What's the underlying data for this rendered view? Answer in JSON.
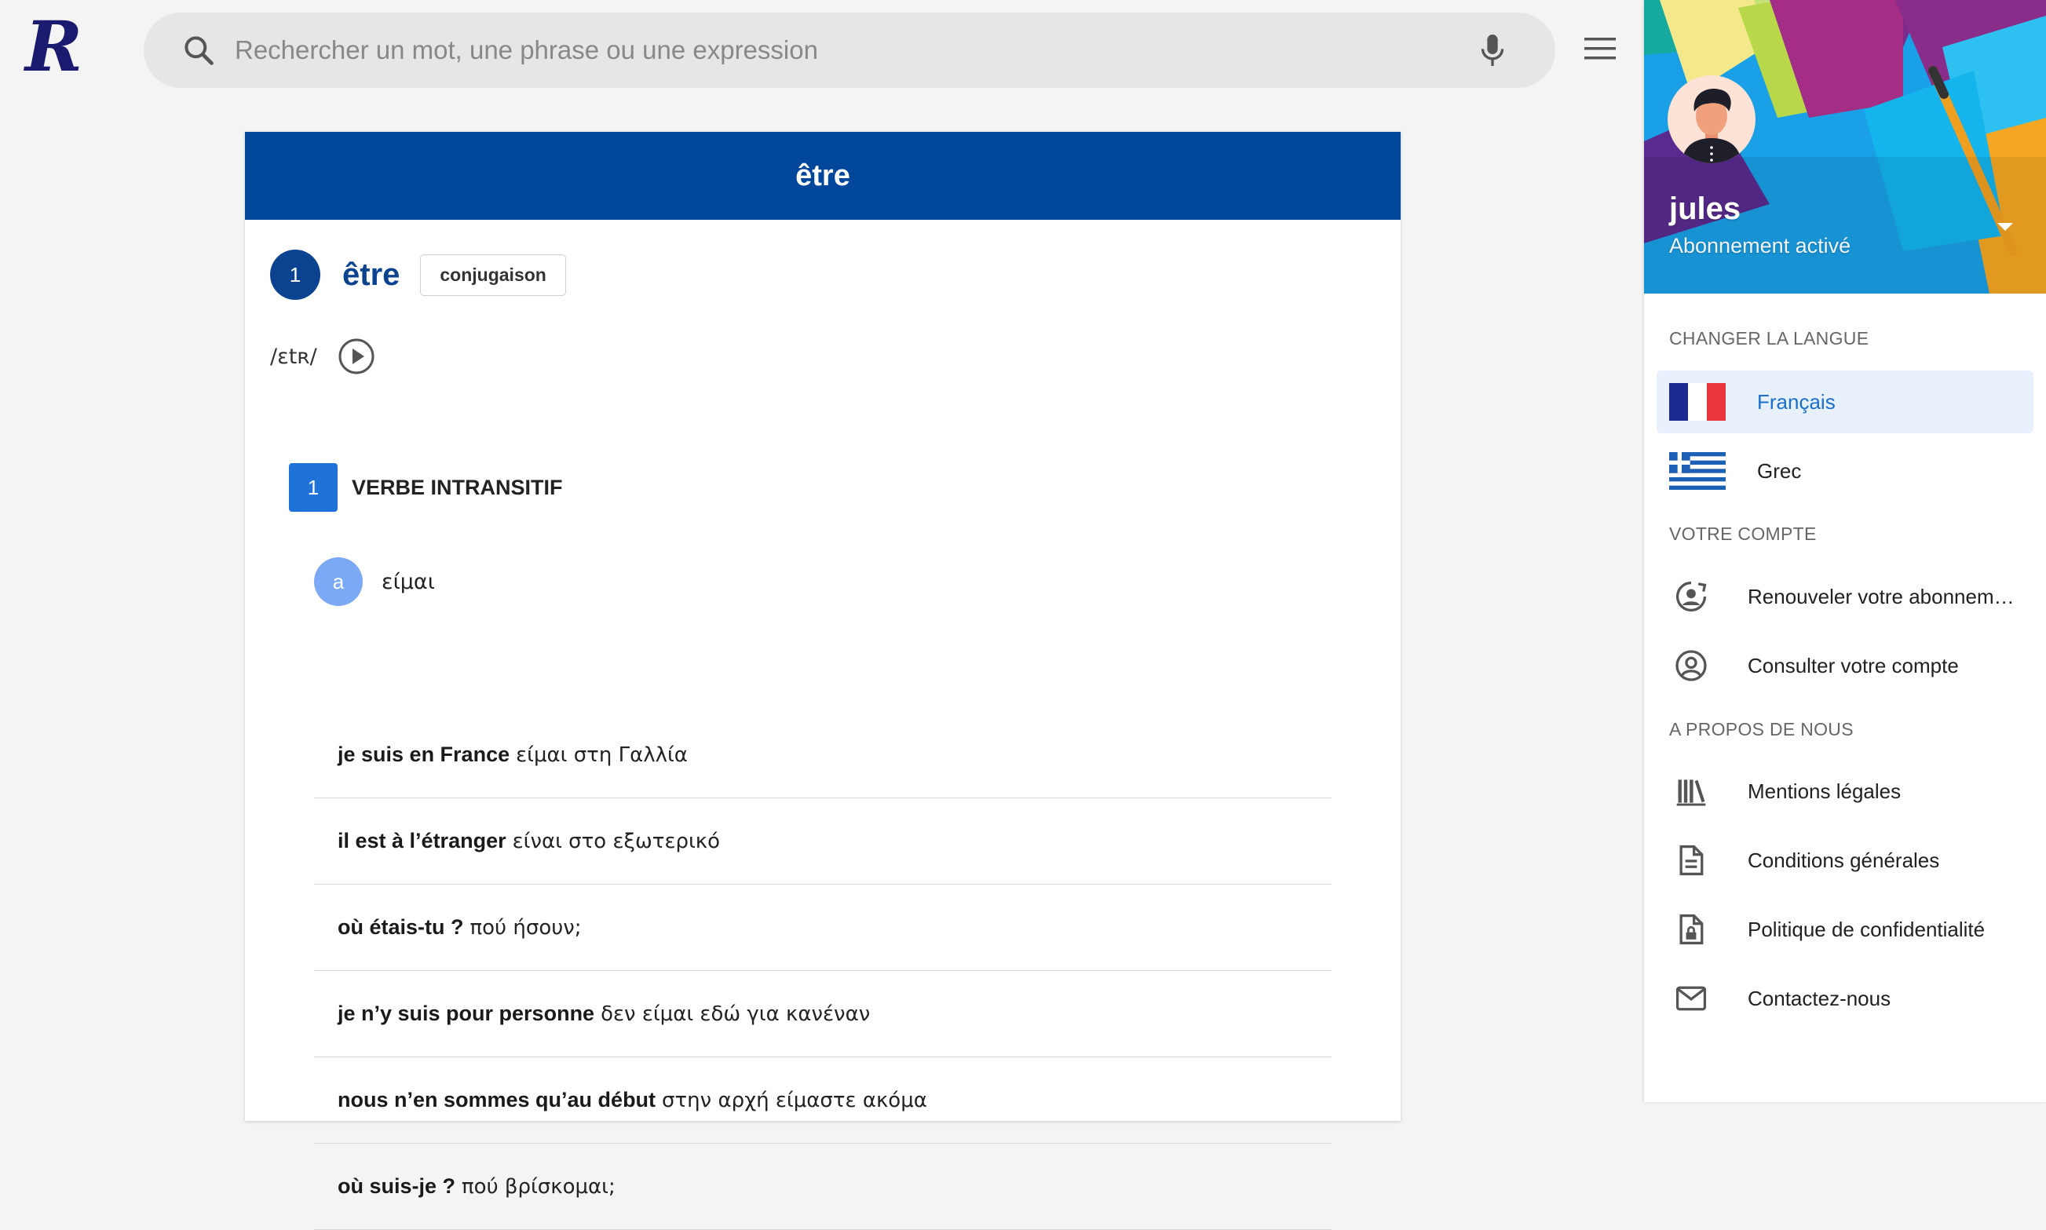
{
  "header": {
    "logo_letter": "R",
    "search": {
      "placeholder": "Rechercher un mot, une phrase ou une expression",
      "value": ""
    },
    "icons": {
      "search": "search-icon",
      "mic": "mic-icon",
      "menu": "menu-icon"
    }
  },
  "card": {
    "title": "être",
    "entry_number": "1",
    "headword": "être",
    "conjugation_button": "conjugaison",
    "phonetic": "/ɛtʀ/",
    "sense": {
      "number": "1",
      "label": "VERBE INTRANSITIF"
    },
    "translation": {
      "letter": "a",
      "text": "είμαι"
    },
    "examples": [
      {
        "fr": "je suis en France",
        "gr": "είμαι στη Γαλλία"
      },
      {
        "fr": "il est à l’étranger",
        "gr": "είναι στο εξωτερικό"
      },
      {
        "fr": "où étais-tu ?",
        "gr": "πού ήσουν;"
      },
      {
        "fr": "je n’y suis pour personne",
        "gr": "δεν είμαι εδώ για κανέναν"
      },
      {
        "fr": "nous n’en sommes qu’au début",
        "gr": "στην αρχή είμαστε ακόμα"
      },
      {
        "fr": "où suis-je ?",
        "gr": "πού βρίσκομαι;"
      }
    ]
  },
  "panel": {
    "user": {
      "name": "jules",
      "status": "Abonnement activé"
    },
    "sections": {
      "language": "CHANGER LA LANGUE",
      "account": "VOTRE COMPTE",
      "about": "A PROPOS DE NOUS"
    },
    "languages": [
      {
        "label": "Français",
        "flag": "france-flag",
        "active": true
      },
      {
        "label": "Grec",
        "flag": "greece-flag",
        "active": false
      }
    ],
    "account_items": [
      {
        "label": "Renouveler votre abonnement",
        "icon": "renew-account-icon"
      },
      {
        "label": "Consulter votre compte",
        "icon": "account-circle-icon"
      }
    ],
    "about_items": [
      {
        "label": "Mentions légales",
        "icon": "library-books-icon"
      },
      {
        "label": "Conditions générales",
        "icon": "document-icon"
      },
      {
        "label": "Politique de confidentialité",
        "icon": "lock-document-icon"
      },
      {
        "label": "Contactez-nous",
        "icon": "mail-icon"
      }
    ]
  },
  "colors": {
    "brand_blue": "#00479b",
    "accent_blue": "#1f72d8",
    "active_bg": "#e7f0fb",
    "active_text": "#1a6fcf"
  }
}
